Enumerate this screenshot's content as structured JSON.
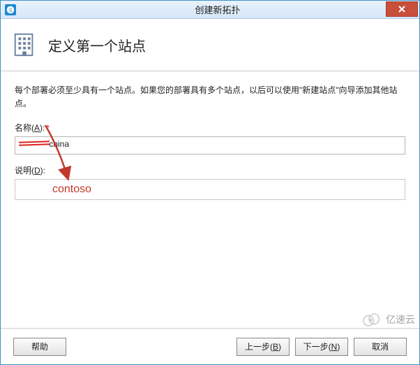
{
  "window": {
    "title": "创建新拓扑"
  },
  "header": {
    "title": "定义第一个站点"
  },
  "intro": "每个部署必须至少具有一个站点。如果您的部署具有多个站点，以后可以使用\"新建站点\"向导添加其他站点。",
  "fields": {
    "name_label_prefix": "名称(",
    "name_label_key": "A",
    "name_label_suffix": "):",
    "name_required": "*",
    "name_value_hidden_prefix": "",
    "name_value_suffix": "china",
    "desc_label_prefix": "说明(",
    "desc_label_key": "D",
    "desc_label_suffix": "):",
    "desc_value": ""
  },
  "annotation": "contoso",
  "buttons": {
    "help": "帮助",
    "back_prefix": "上一步(",
    "back_key": "B",
    "back_suffix": ")",
    "next_prefix": "下一步(",
    "next_key": "N",
    "next_suffix": ")",
    "cancel": "取消"
  },
  "watermark": "亿速云"
}
